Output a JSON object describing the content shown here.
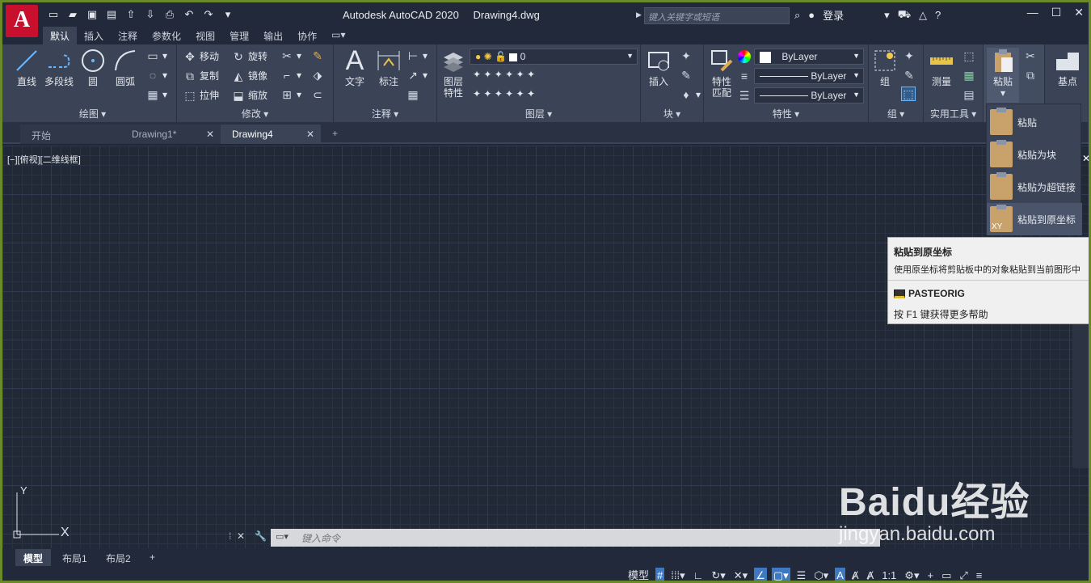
{
  "app": {
    "title": "Autodesk AutoCAD 2020",
    "document": "Drawing4.dwg",
    "logo_letter": "A"
  },
  "search": {
    "placeholder": "键入关键字或短语"
  },
  "user": {
    "login_label": "登录"
  },
  "menu_tabs": [
    "默认",
    "插入",
    "注释",
    "参数化",
    "视图",
    "管理",
    "输出",
    "协作"
  ],
  "ribbon": {
    "draw": {
      "label": "绘图",
      "line": "直线",
      "polyline": "多段线",
      "circle": "圆",
      "arc": "圆弧"
    },
    "modify": {
      "label": "修改",
      "move": "移动",
      "rotate": "旋转",
      "copy": "复制",
      "mirror": "镜像",
      "stretch": "拉伸",
      "scale": "缩放"
    },
    "annotation": {
      "label": "注释",
      "text": "文字",
      "dimension": "标注"
    },
    "layers": {
      "label": "图层",
      "layer_props": "图层\n特性",
      "current_layer": "0"
    },
    "block": {
      "label": "块",
      "insert": "插入"
    },
    "properties": {
      "label": "特性",
      "match": "特性\n匹配",
      "color": "ByLayer",
      "linetype": "ByLayer",
      "lineweight": "ByLayer"
    },
    "groups": {
      "label": "组",
      "group": "组"
    },
    "utilities": {
      "label": "实用工具",
      "measure": "测量"
    },
    "clipboard": {
      "paste": "粘贴"
    },
    "view": {
      "basepoint": "基点"
    }
  },
  "paste_menu": [
    "粘贴",
    "粘贴为块",
    "粘贴为超链接",
    "粘贴到原坐标"
  ],
  "paste_menu_badge": "XY",
  "doc_tabs": [
    {
      "label": "开始"
    },
    {
      "label": "Drawing1*"
    },
    {
      "label": "Drawing4"
    }
  ],
  "viewport_label": "[−][俯视][二维线框]",
  "ucs": {
    "x": "X",
    "y": "Y"
  },
  "tooltip": {
    "title": "粘贴到原坐标",
    "description": "使用原坐标将剪贴板中的对象粘贴到当前图形中",
    "command": "PASTEORIG",
    "help": "按 F1 键获得更多帮助"
  },
  "command_line": {
    "placeholder": "键入命令"
  },
  "layout_tabs": [
    "模型",
    "布局1",
    "布局2"
  ],
  "status": {
    "model": "模型",
    "scale": "1:1"
  },
  "watermark": {
    "brand": "Baidu经验",
    "url": "jingyan.baidu.com"
  }
}
